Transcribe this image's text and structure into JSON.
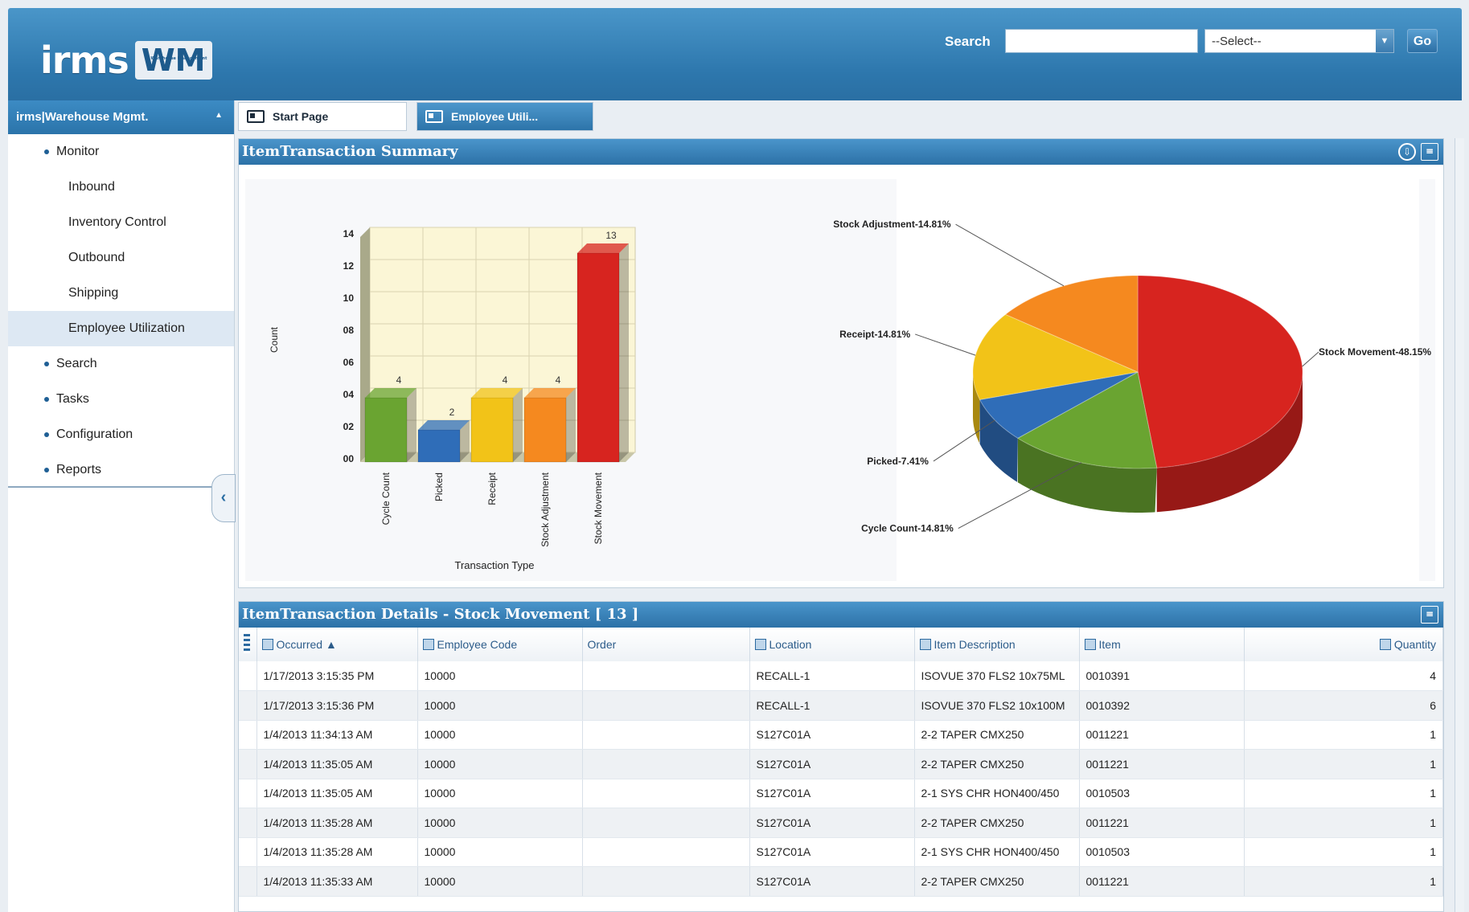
{
  "header": {
    "logo_text": "irms",
    "logo_badge": "WM",
    "logo_badge_sub": "Warehouse Management",
    "search_label": "Search",
    "search_value": "",
    "select_value": "--Select--",
    "go_label": "Go"
  },
  "sidebar": {
    "title": "irms|Warehouse Mgmt.",
    "items": [
      {
        "label": "Monitor"
      },
      {
        "label": "Inbound"
      },
      {
        "label": "Inventory Control"
      },
      {
        "label": "Outbound"
      },
      {
        "label": "Shipping"
      },
      {
        "label": "Employee Utilization"
      },
      {
        "label": "Search"
      },
      {
        "label": "Tasks"
      },
      {
        "label": "Configuration"
      },
      {
        "label": "Reports"
      }
    ]
  },
  "tabs": [
    {
      "label": "Start Page"
    },
    {
      "label": "Employee Utili..."
    }
  ],
  "summary_panel": {
    "title": "ItemTransaction Summary"
  },
  "details_panel": {
    "title": "ItemTransaction Details - Stock Movement [ 13 ]"
  },
  "chart_data": [
    {
      "type": "bar",
      "categories": [
        "Cycle Count",
        "Picked",
        "Receipt",
        "Stock Adjustment",
        "Stock Movement"
      ],
      "values": [
        4,
        2,
        4,
        4,
        13
      ],
      "value_labels": [
        "4",
        "2",
        "4",
        "4",
        "13"
      ],
      "ytick_labels": [
        "00",
        "02",
        "04",
        "06",
        "08",
        "10",
        "12",
        "14"
      ],
      "ylim": [
        0,
        14
      ],
      "xlabel": "Transaction Type",
      "ylabel": "Count",
      "colors": [
        "#6aa431",
        "#2f6db8",
        "#f2c318",
        "#f5891f",
        "#d7241f"
      ]
    },
    {
      "type": "pie",
      "categories": [
        "Stock Movement",
        "Cycle Count",
        "Picked",
        "Receipt",
        "Stock Adjustment"
      ],
      "values": [
        48.15,
        14.81,
        7.41,
        14.81,
        14.81
      ],
      "labels": [
        "Stock Movement-48.15%",
        "Cycle Count-14.81%",
        "Picked-7.41%",
        "Receipt-14.81%",
        "Stock Adjustment-14.81%"
      ],
      "colors": [
        "#d7241f",
        "#6aa431",
        "#2f6db8",
        "#f2c318",
        "#f5891f"
      ]
    }
  ],
  "table": {
    "columns": [
      "Occurred",
      "Employee Code",
      "Order",
      "Location",
      "Item Description",
      "Item",
      "Quantity"
    ],
    "rows": [
      [
        "1/17/2013 3:15:35 PM",
        "10000",
        "",
        "RECALL-1",
        "ISOVUE 370 FLS2 10x75ML",
        "0010391",
        "4"
      ],
      [
        "1/17/2013 3:15:36 PM",
        "10000",
        "",
        "RECALL-1",
        "ISOVUE 370 FLS2 10x100M",
        "0010392",
        "6"
      ],
      [
        "1/4/2013 11:34:13 AM",
        "10000",
        "",
        "S127C01A",
        "2-2 TAPER CMX250",
        "0011221",
        "1"
      ],
      [
        "1/4/2013 11:35:05 AM",
        "10000",
        "",
        "S127C01A",
        "2-2 TAPER CMX250",
        "0011221",
        "1"
      ],
      [
        "1/4/2013 11:35:05 AM",
        "10000",
        "",
        "S127C01A",
        "2-1 SYS CHR HON400/450",
        "0010503",
        "1"
      ],
      [
        "1/4/2013 11:35:28 AM",
        "10000",
        "",
        "S127C01A",
        "2-2 TAPER CMX250",
        "0011221",
        "1"
      ],
      [
        "1/4/2013 11:35:28 AM",
        "10000",
        "",
        "S127C01A",
        "2-1 SYS CHR HON400/450",
        "0010503",
        "1"
      ],
      [
        "1/4/2013 11:35:33 AM",
        "10000",
        "",
        "S127C01A",
        "2-2 TAPER CMX250",
        "0011221",
        "1"
      ]
    ]
  }
}
